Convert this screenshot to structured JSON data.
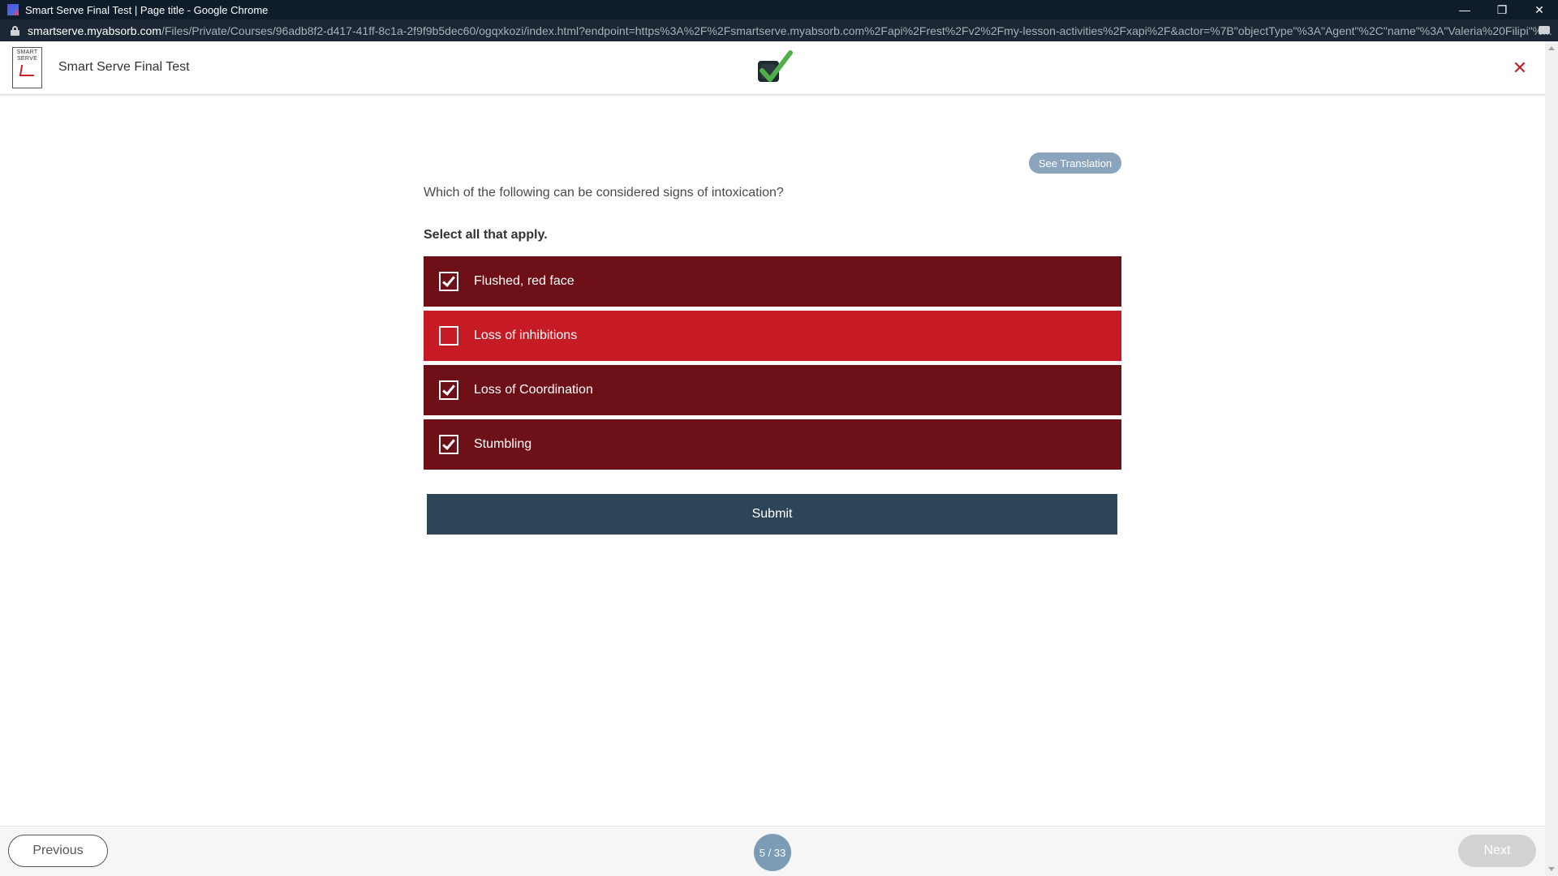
{
  "browser": {
    "window_title": "Smart Serve Final Test | Page title - Google Chrome",
    "url_host": "smartserve.myabsorb.com",
    "url_path": "/Files/Private/Courses/96adb8f2-d417-41ff-8c1a-2f9f9b5dec60/ogqxkozi/index.html?endpoint=https%3A%2F%2Fsmartserve.myabsorb.com%2Fapi%2Frest%2Fv2%2Fmy-lesson-activities%2Fxapi%2F&actor=%7B\"objectType\"%3A\"Agent\"%2C\"name\"%3A\"Valeria%20Filipi\"%..."
  },
  "header": {
    "logo_text": "SMART SERVE",
    "course_title": "Smart Serve Final Test",
    "close_icon": "close-icon"
  },
  "question": {
    "translation_button": "See Translation",
    "text": "Which of the following can be considered signs of intoxication?",
    "instruction": "Select all that apply.",
    "options": [
      {
        "label": "Flushed, red face",
        "checked": true
      },
      {
        "label": "Loss of inhibitions",
        "checked": false
      },
      {
        "label": "Loss of Coordination",
        "checked": true
      },
      {
        "label": "Stumbling",
        "checked": true
      }
    ],
    "submit_label": "Submit"
  },
  "footer": {
    "previous_label": "Previous",
    "page_counter": "5 / 33",
    "next_label": "Next"
  },
  "colors": {
    "selected_option": "#6d1018",
    "unselected_option": "#c61b25",
    "submit": "#2d4556",
    "accent_red": "#c8202b"
  }
}
